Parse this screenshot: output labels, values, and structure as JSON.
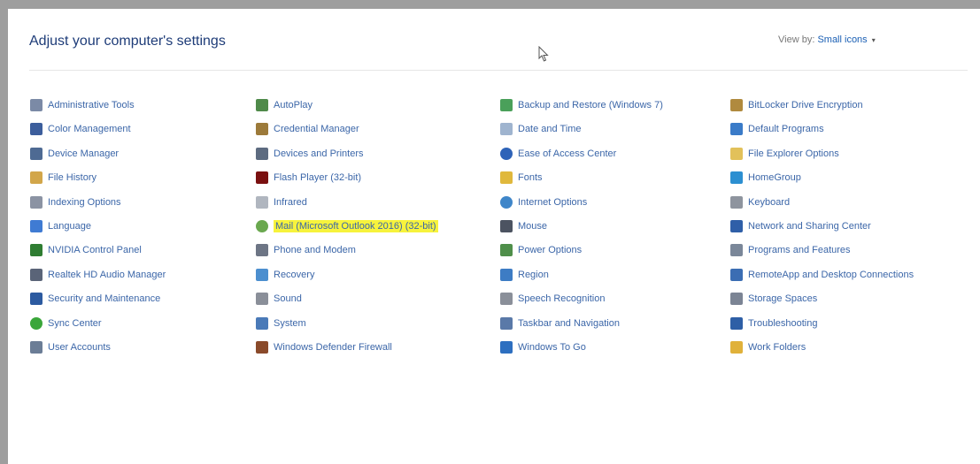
{
  "header": {
    "title": "Adjust your computer's settings",
    "view_by_label": "View by:",
    "view_by_value": "Small icons",
    "view_by_caret": "▾"
  },
  "columns": [
    [
      {
        "label": "Administrative Tools",
        "icon": "admin-tools-icon",
        "color": "#7b8aa6"
      },
      {
        "label": "Color Management",
        "icon": "color-management-icon",
        "color": "#3c5e9c"
      },
      {
        "label": "Device Manager",
        "icon": "device-manager-icon",
        "color": "#4e6a93"
      },
      {
        "label": "File History",
        "icon": "file-history-icon",
        "color": "#d2a64a"
      },
      {
        "label": "Indexing Options",
        "icon": "indexing-options-icon",
        "color": "#8b93a3"
      },
      {
        "label": "Language",
        "icon": "language-icon",
        "color": "#3f7bd3"
      },
      {
        "label": "NVIDIA Control Panel",
        "icon": "nvidia-icon",
        "color": "#2f7d32"
      },
      {
        "label": "Realtek HD Audio Manager",
        "icon": "realtek-audio-icon",
        "color": "#5a6478"
      },
      {
        "label": "Security and Maintenance",
        "icon": "security-flag-icon",
        "color": "#2c5aa0"
      },
      {
        "label": "Sync Center",
        "icon": "sync-center-icon",
        "color": "#3aa63a"
      },
      {
        "label": "User Accounts",
        "icon": "user-accounts-icon",
        "color": "#6b7d96"
      }
    ],
    [
      {
        "label": "AutoPlay",
        "icon": "autoplay-icon",
        "color": "#4f8a4a"
      },
      {
        "label": "Credential Manager",
        "icon": "credential-manager-icon",
        "color": "#9c7a3a"
      },
      {
        "label": "Devices and Printers",
        "icon": "devices-printers-icon",
        "color": "#5d6b80"
      },
      {
        "label": "Flash Player (32-bit)",
        "icon": "flash-player-icon",
        "color": "#7a1010"
      },
      {
        "label": "Infrared",
        "icon": "infrared-icon",
        "color": "#b0b6bf"
      },
      {
        "label": "Mail (Microsoft Outlook 2016) (32-bit)",
        "icon": "mail-icon",
        "color": "#6aa84f",
        "highlight": true
      },
      {
        "label": "Phone and Modem",
        "icon": "phone-modem-icon",
        "color": "#6d7585"
      },
      {
        "label": "Recovery",
        "icon": "recovery-icon",
        "color": "#4c8fcf"
      },
      {
        "label": "Sound",
        "icon": "sound-icon",
        "color": "#8a8f99"
      },
      {
        "label": "System",
        "icon": "system-icon",
        "color": "#4a7ab8"
      },
      {
        "label": "Windows Defender Firewall",
        "icon": "firewall-icon",
        "color": "#8a4a2a"
      }
    ],
    [
      {
        "label": "Backup and Restore (Windows 7)",
        "icon": "backup-restore-icon",
        "color": "#4aa05a"
      },
      {
        "label": "Date and Time",
        "icon": "date-time-icon",
        "color": "#9fb4cf"
      },
      {
        "label": "Ease of Access Center",
        "icon": "ease-of-access-icon",
        "color": "#2e63b8"
      },
      {
        "label": "Fonts",
        "icon": "fonts-icon",
        "color": "#e0b83c"
      },
      {
        "label": "Internet Options",
        "icon": "internet-options-icon",
        "color": "#3f86c9"
      },
      {
        "label": "Mouse",
        "icon": "mouse-icon",
        "color": "#4c5361"
      },
      {
        "label": "Power Options",
        "icon": "power-options-icon",
        "color": "#4f8f4a"
      },
      {
        "label": "Region",
        "icon": "region-icon",
        "color": "#3d7cc4"
      },
      {
        "label": "Speech Recognition",
        "icon": "speech-recognition-icon",
        "color": "#8a8f99"
      },
      {
        "label": "Taskbar and Navigation",
        "icon": "taskbar-navigation-icon",
        "color": "#5a79a8"
      },
      {
        "label": "Windows To Go",
        "icon": "windows-to-go-icon",
        "color": "#2d6fc0"
      }
    ],
    [
      {
        "label": "BitLocker Drive Encryption",
        "icon": "bitlocker-icon",
        "color": "#b08a3e"
      },
      {
        "label": "Default Programs",
        "icon": "default-programs-icon",
        "color": "#3a7bc8"
      },
      {
        "label": "File Explorer Options",
        "icon": "file-explorer-options-icon",
        "color": "#e2c15a"
      },
      {
        "label": "HomeGroup",
        "icon": "homegroup-icon",
        "color": "#2c8fd1"
      },
      {
        "label": "Keyboard",
        "icon": "keyboard-icon",
        "color": "#8e949e"
      },
      {
        "label": "Network and Sharing Center",
        "icon": "network-sharing-icon",
        "color": "#2f5fa8"
      },
      {
        "label": "Programs and Features",
        "icon": "programs-features-icon",
        "color": "#7a8799"
      },
      {
        "label": "RemoteApp and Desktop Connections",
        "icon": "remoteapp-icon",
        "color": "#3b6db3"
      },
      {
        "label": "Storage Spaces",
        "icon": "storage-spaces-icon",
        "color": "#7b8494"
      },
      {
        "label": "Troubleshooting",
        "icon": "troubleshooting-icon",
        "color": "#2e5fa6"
      },
      {
        "label": "Work Folders",
        "icon": "work-folders-icon",
        "color": "#e0b13a"
      }
    ]
  ]
}
